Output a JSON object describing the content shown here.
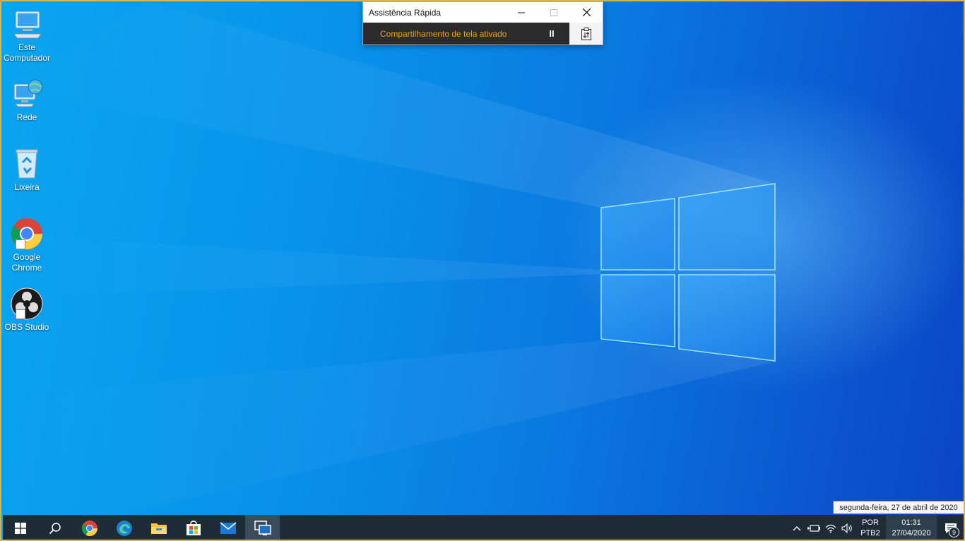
{
  "colors": {
    "taskbar": "#1f2b36",
    "status_text": "#f0a30a",
    "screen_border": "#d8b44a",
    "accent": "#7ab8f5"
  },
  "desktop_icons": [
    {
      "label": "Este\nComputador",
      "icon": "computer-icon"
    },
    {
      "label": "Rede",
      "icon": "network-icon"
    },
    {
      "label": "Lixeira",
      "icon": "recycle-bin-icon"
    },
    {
      "label": "Google\nChrome",
      "icon": "chrome-icon"
    },
    {
      "label": "OBS Studio",
      "icon": "obs-icon"
    }
  ],
  "quick_assist": {
    "title": "Assistência Rápida",
    "status": "Compartilhamento de tela ativado",
    "pause_glyph": "II"
  },
  "tooltip": "segunda-feira, 27 de abril de 2020",
  "taskbar": {
    "buttons": [
      "start-icon",
      "search-icon",
      "chrome-icon",
      "edge-icon",
      "file-explorer-icon",
      "store-icon",
      "mail-icon",
      "quick-assist-icon"
    ]
  },
  "tray": {
    "lang_top": "POR",
    "lang_bottom": "PTB2",
    "time": "01:31",
    "date": "27/04/2020",
    "notifications": "9"
  }
}
